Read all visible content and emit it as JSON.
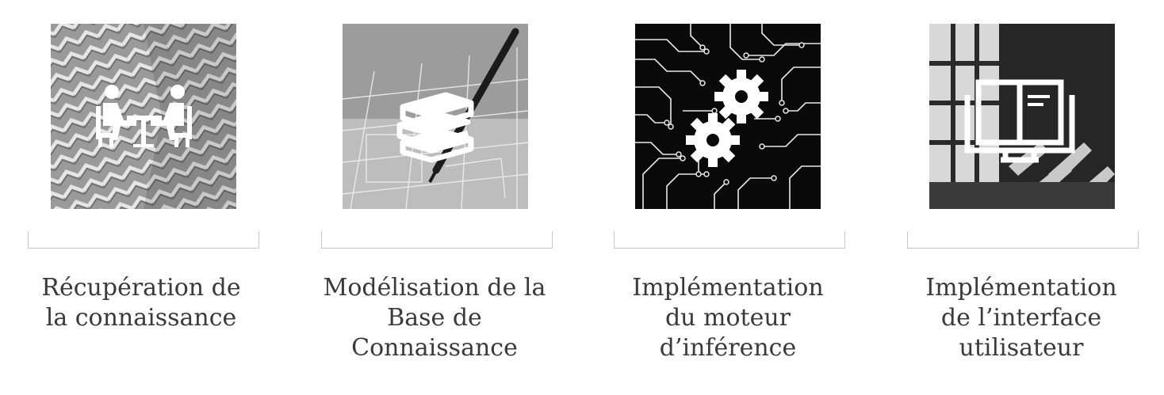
{
  "steps": [
    {
      "icon": "meeting-icon",
      "background": "pattern-texture",
      "label_lines": [
        "Récupération de",
        "la connaissance"
      ]
    },
    {
      "icon": "books-icon",
      "background": "blueprint-pen",
      "label_lines": [
        "Modélisation de la",
        "Base de",
        "Connaissance"
      ]
    },
    {
      "icon": "gears-icon",
      "background": "circuit-board",
      "label_lines": [
        "Implémentation",
        "du moteur",
        "d’inférence"
      ]
    },
    {
      "icon": "interface-window-icon",
      "background": "window-light",
      "label_lines": [
        "Implémentation",
        "de l’interface",
        "utilisateur"
      ]
    }
  ],
  "colors": {
    "label_text": "#3a3a3a",
    "bracket": "#c8c8c8",
    "icon": "#ffffff"
  }
}
